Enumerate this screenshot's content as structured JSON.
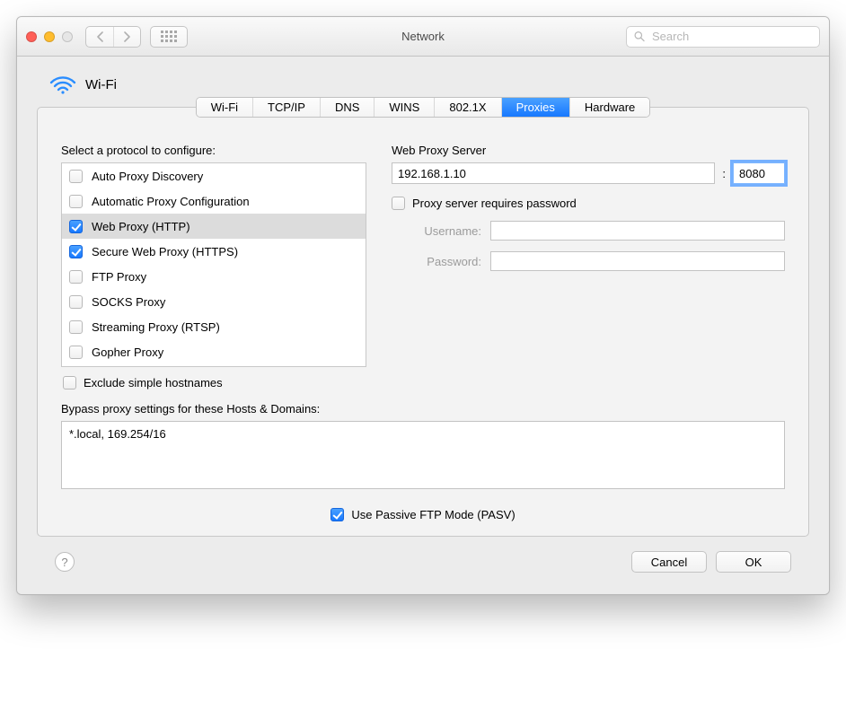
{
  "window": {
    "title": "Network"
  },
  "search": {
    "placeholder": "Search"
  },
  "header": {
    "interface": "Wi-Fi"
  },
  "tabs": [
    "Wi-Fi",
    "TCP/IP",
    "DNS",
    "WINS",
    "802.1X",
    "Proxies",
    "Hardware"
  ],
  "active_tab": "Proxies",
  "left": {
    "label": "Select a protocol to configure:",
    "protocols": [
      {
        "label": "Auto Proxy Discovery",
        "checked": false
      },
      {
        "label": "Automatic Proxy Configuration",
        "checked": false
      },
      {
        "label": "Web Proxy (HTTP)",
        "checked": true
      },
      {
        "label": "Secure Web Proxy (HTTPS)",
        "checked": true
      },
      {
        "label": "FTP Proxy",
        "checked": false
      },
      {
        "label": "SOCKS Proxy",
        "checked": false
      },
      {
        "label": "Streaming Proxy (RTSP)",
        "checked": false
      },
      {
        "label": "Gopher Proxy",
        "checked": false
      }
    ],
    "selected_index": 2,
    "exclude_simple": "Exclude simple hostnames"
  },
  "right": {
    "label": "Web Proxy Server",
    "host": "192.168.1.10",
    "port": "8080",
    "auth_label": "Proxy server requires password",
    "username_label": "Username:",
    "password_label": "Password:",
    "username": "",
    "password": ""
  },
  "bypass": {
    "label": "Bypass proxy settings for these Hosts & Domains:",
    "value": "*.local, 169.254/16"
  },
  "pasv": {
    "label": "Use Passive FTP Mode (PASV)"
  },
  "footer": {
    "cancel": "Cancel",
    "ok": "OK"
  }
}
